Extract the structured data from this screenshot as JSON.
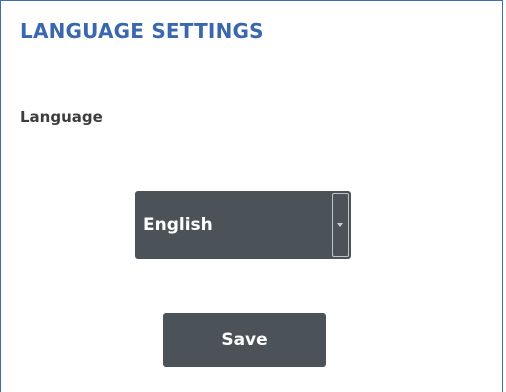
{
  "panel": {
    "title": "LANGUAGE SETTINGS"
  },
  "language": {
    "label": "Language",
    "selected": "English",
    "toggle_icon": "chevron-down-icon"
  },
  "actions": {
    "save_label": "Save"
  },
  "colors": {
    "title": "#3a67ad",
    "border": "#3b6db0",
    "control_bg": "#4b5258",
    "control_text": "#ffffff"
  }
}
